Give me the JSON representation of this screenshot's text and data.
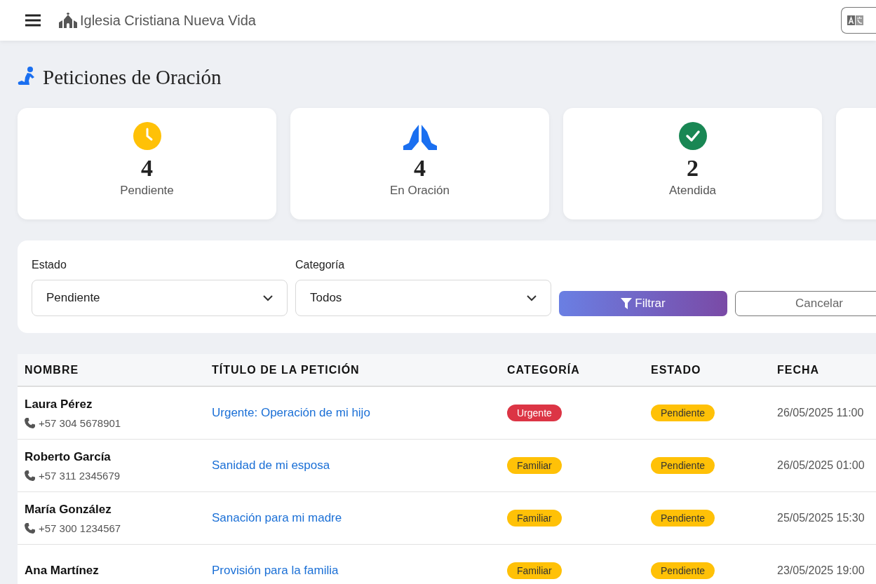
{
  "header": {
    "title": "Iglesia Cristiana Nueva Vida"
  },
  "page_title": "Peticiones de Oración",
  "stats": [
    {
      "kind": "clock",
      "value": "4",
      "label": "Pendiente"
    },
    {
      "kind": "hands",
      "value": "4",
      "label": "En Oración"
    },
    {
      "kind": "check",
      "value": "2",
      "label": "Atendida"
    }
  ],
  "filters": {
    "fields": [
      {
        "label": "Estado",
        "value": "Pendiente"
      },
      {
        "label": "Categoría",
        "value": "Todos"
      }
    ],
    "buttons": [
      {
        "kind": "primary",
        "label": "Filtrar"
      },
      {
        "kind": "outline",
        "label": "Cancelar"
      }
    ]
  },
  "table": {
    "columns": [
      "NOMBRE",
      "TÍTULO DE LA PETICIÓN",
      "CATEGORÍA",
      "ESTADO",
      "FECHA"
    ],
    "rows": [
      {
        "name": "Laura Pérez",
        "phone": "+57 304 5678901",
        "title": "Urgente: Operación de mi hijo",
        "category": {
          "label": "Urgente",
          "color": "#dc3545"
        },
        "status": {
          "label": "Pendiente",
          "color": "#ffc107"
        },
        "date": "26/05/2025 11:00"
      },
      {
        "name": "Roberto García",
        "phone": "+57 311 2345679",
        "title": "Sanidad de mi esposa",
        "category": {
          "label": "Familiar",
          "color": "#ffc107"
        },
        "status": {
          "label": "Pendiente",
          "color": "#ffc107"
        },
        "date": "26/05/2025 01:00"
      },
      {
        "name": "María González",
        "phone": "+57 300 1234567",
        "title": "Sanación para mi madre",
        "category": {
          "label": "Familiar",
          "color": "#ffc107"
        },
        "status": {
          "label": "Pendiente",
          "color": "#ffc107"
        },
        "date": "25/05/2025 15:30"
      },
      {
        "name": "Ana Martínez",
        "title": "Provisión para la familia",
        "category": {
          "label": "Familiar",
          "color": "#ffc107"
        },
        "status": {
          "label": "Pendiente",
          "color": "#ffc107"
        },
        "date": "23/05/2025 19:00"
      }
    ]
  }
}
